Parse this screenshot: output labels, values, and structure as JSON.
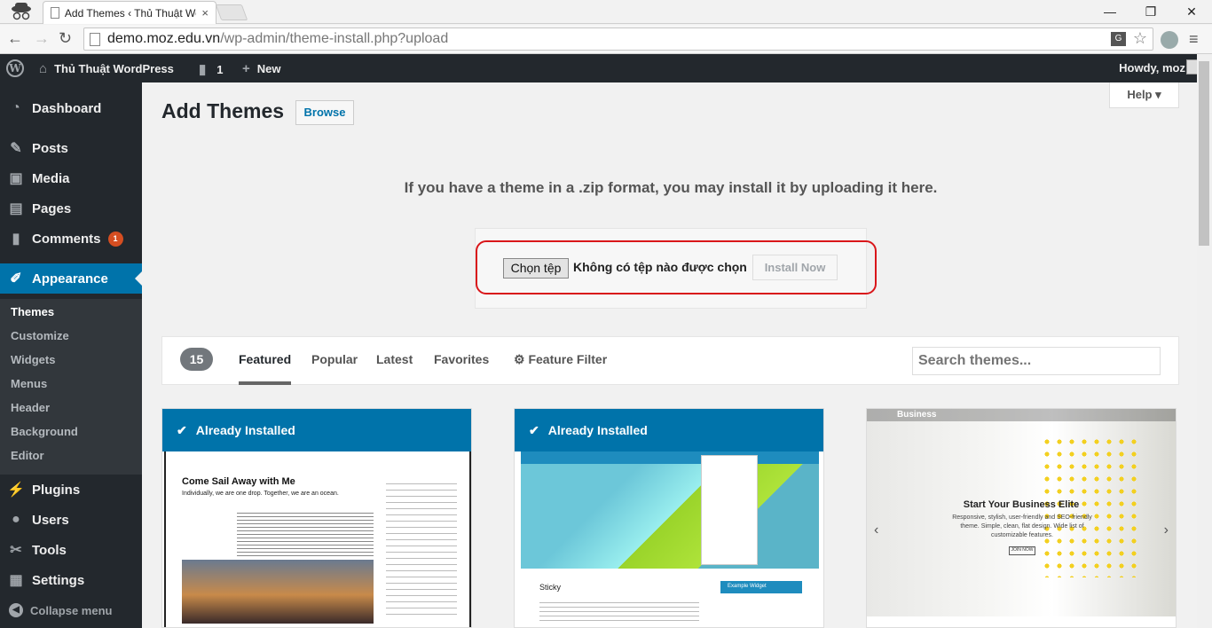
{
  "browser": {
    "tab_title": "Add Themes ‹ Thủ Thuật WordPress",
    "url_host": "demo.moz.edu.vn",
    "url_path": "/wp-admin/theme-install.php?upload",
    "win_min": "—",
    "win_restore": "❐",
    "win_close": "✕",
    "tab_close": "×"
  },
  "adminbar": {
    "wp_logo": "W",
    "site_name": "Thủ Thuật WordPress",
    "comments_count": "1",
    "new_label": "New",
    "howdy": "Howdy, moz"
  },
  "sidebar": {
    "items": [
      {
        "icon": "dashboard-icon",
        "label": "Dashboard"
      },
      {
        "icon": "posts-icon",
        "label": "Posts"
      },
      {
        "icon": "media-icon",
        "label": "Media"
      },
      {
        "icon": "pages-icon",
        "label": "Pages"
      },
      {
        "icon": "comments-icon",
        "label": "Comments",
        "badge": "1"
      },
      {
        "icon": "appearance-icon",
        "label": "Appearance"
      },
      {
        "icon": "plugins-icon",
        "label": "Plugins"
      },
      {
        "icon": "users-icon",
        "label": "Users"
      },
      {
        "icon": "tools-icon",
        "label": "Tools"
      },
      {
        "icon": "settings-icon",
        "label": "Settings"
      }
    ],
    "submenu": [
      "Themes",
      "Customize",
      "Widgets",
      "Menus",
      "Header",
      "Background",
      "Editor"
    ],
    "collapse": "Collapse menu"
  },
  "page": {
    "title": "Add Themes",
    "browse_button": "Browse",
    "help": "Help"
  },
  "upload": {
    "message": "If you have a theme in a .zip format, you may install it by uploading it here.",
    "choose_file": "Chọn tệp",
    "no_file": "Không có tệp nào được chọn",
    "install_now": "Install Now"
  },
  "filter": {
    "count": "15",
    "tabs": [
      "Featured",
      "Popular",
      "Latest",
      "Favorites"
    ],
    "feature_filter": "Feature Filter",
    "search_placeholder": "Search themes..."
  },
  "themes": [
    {
      "status": "Already Installed",
      "heading": "Come Sail Away with Me",
      "sub": "Individually, we are one drop. Together, we are an ocean."
    },
    {
      "status": "Already Installed",
      "post": "Sticky",
      "widget": "Example Widget"
    },
    {
      "brand": "Business",
      "heading": "Start Your Business Elite",
      "text": "Responsive, stylish, user-friendly and SEO-friendly theme. Simple, clean, flat design. Wide list of customizable features.",
      "button": "JOIN NOW"
    }
  ],
  "colors": {
    "accent": "#0073aa",
    "adminbar": "#23282d",
    "highlight_ring": "#d9161a",
    "badge": "#d54e21"
  }
}
